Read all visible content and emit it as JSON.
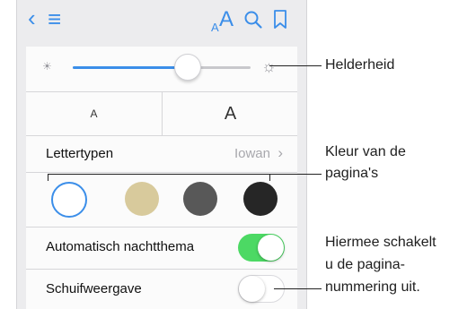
{
  "toolbar": {
    "back_icon": "‹",
    "toc_icon": "≡",
    "font_icon_label": "A",
    "search_icon": "search-icon",
    "bookmark_icon": "bookmark-icon"
  },
  "brightness": {
    "level": 0.64,
    "low_icon": "☀",
    "high_icon": "☼"
  },
  "font_size": {
    "smaller_label": "A",
    "larger_label": "A"
  },
  "fonts": {
    "label": "Lettertypen",
    "value": "Iowan",
    "chevron": "›"
  },
  "colors": {
    "swatches": [
      {
        "color": "#ffffff",
        "selected": true
      },
      {
        "color": "#d8ca9c",
        "selected": false
      },
      {
        "color": "#585858",
        "selected": false
      },
      {
        "color": "#262626",
        "selected": false
      }
    ],
    "accent": "#3b8ee9"
  },
  "night_theme": {
    "label": "Automatisch nachtthema",
    "on": true,
    "on_color": "#4cd964"
  },
  "scroll_view": {
    "label": "Schuifweergave",
    "on": false
  },
  "callouts": {
    "brightness": "Helderheid",
    "page_color_line1": "Kleur van de",
    "page_color_line2": "pagina's",
    "scroll_line1": "Hiermee schakelt",
    "scroll_line2": "u de pagina-",
    "scroll_line3": "nummering uit."
  }
}
